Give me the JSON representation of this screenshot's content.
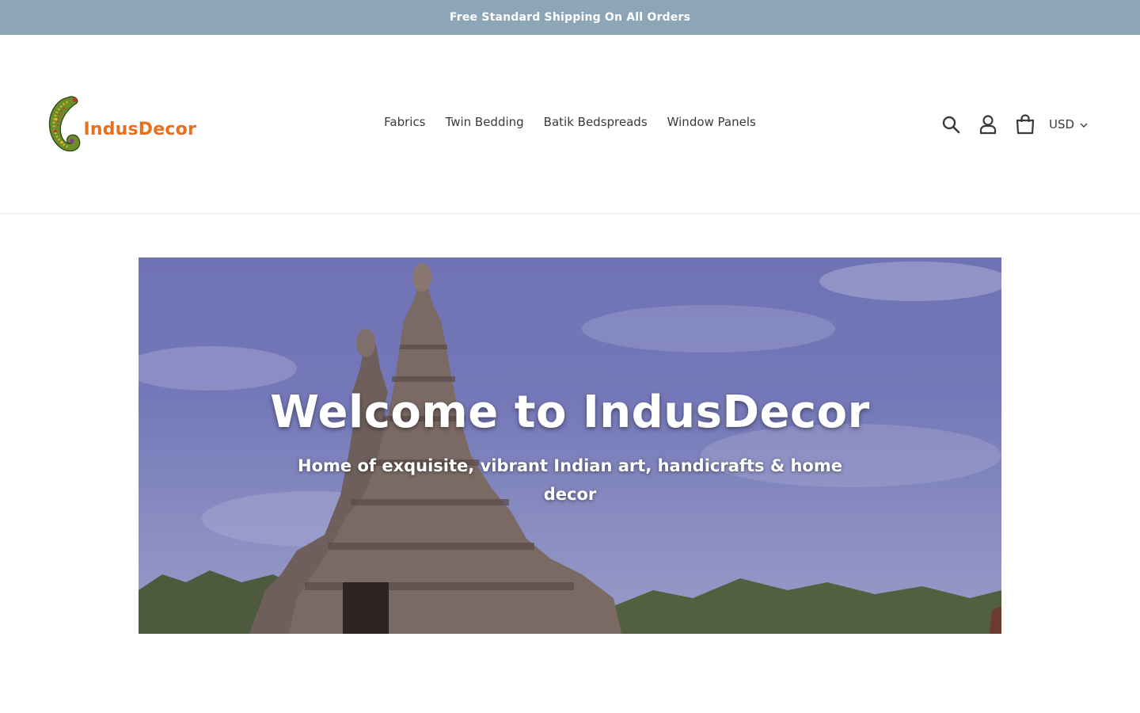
{
  "announcement": {
    "text": "Free Standard Shipping On All Orders"
  },
  "header": {
    "logo_text": "IndusDecor",
    "nav": [
      {
        "label": "Fabrics"
      },
      {
        "label": "Twin Bedding"
      },
      {
        "label": "Batik Bedspreads"
      },
      {
        "label": "Window Panels"
      }
    ],
    "icons": {
      "search": "search-icon",
      "account": "account-icon",
      "cart": "cart-icon"
    },
    "currency": {
      "selected": "USD"
    }
  },
  "hero": {
    "title": "Welcome to IndusDecor",
    "subtitle": "Home of exquisite, vibrant Indian art, handicrafts & home decor"
  },
  "colors": {
    "announcement_bg": "#8ca6b7",
    "logo_orange": "#e8711f",
    "sky": "#7579b8",
    "text": "#3a3a3a"
  }
}
